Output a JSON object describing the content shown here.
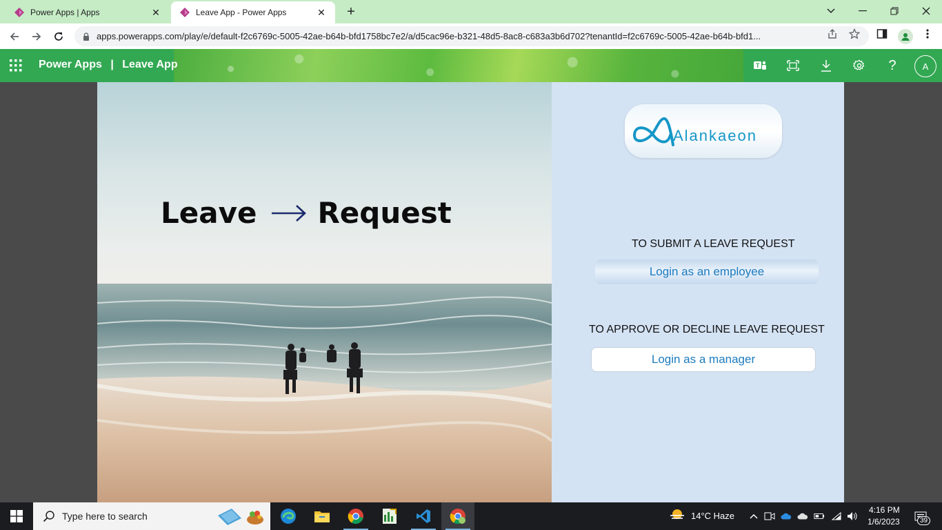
{
  "browser": {
    "tabs": [
      {
        "title": "Power Apps | Apps",
        "active": false
      },
      {
        "title": "Leave App - Power Apps",
        "active": true
      }
    ],
    "url": "apps.powerapps.com/play/e/default-f2c6769c-5005-42ae-b64b-bfd1758bc7e2/a/d5cac96e-b321-48d5-8ac8-c683a3b6d702?tenantId=f2c6769c-5005-42ae-b64b-bfd1..."
  },
  "appbar": {
    "product": "Power Apps",
    "separator": "|",
    "app_name": "Leave App",
    "avatar_initial": "A"
  },
  "hero": {
    "word1": "Leave",
    "word2": "Request"
  },
  "logo": {
    "brand": "Alankaeon"
  },
  "employee_section": {
    "label": "TO SUBMIT A LEAVE REQUEST",
    "button": "Login as an employee"
  },
  "manager_section": {
    "label": "TO APPROVE OR DECLINE LEAVE REQUEST",
    "button": "Login as a manager"
  },
  "taskbar": {
    "search_placeholder": "Type here to search",
    "weather": "14°C  Haze",
    "time": "4:16 PM",
    "date": "1/6/2023",
    "notification_count": "39"
  },
  "colors": {
    "appbar": "#32a852",
    "right_panel": "#d4e3f4",
    "button_text": "#1c7bbf",
    "brand": "#1597c7"
  }
}
